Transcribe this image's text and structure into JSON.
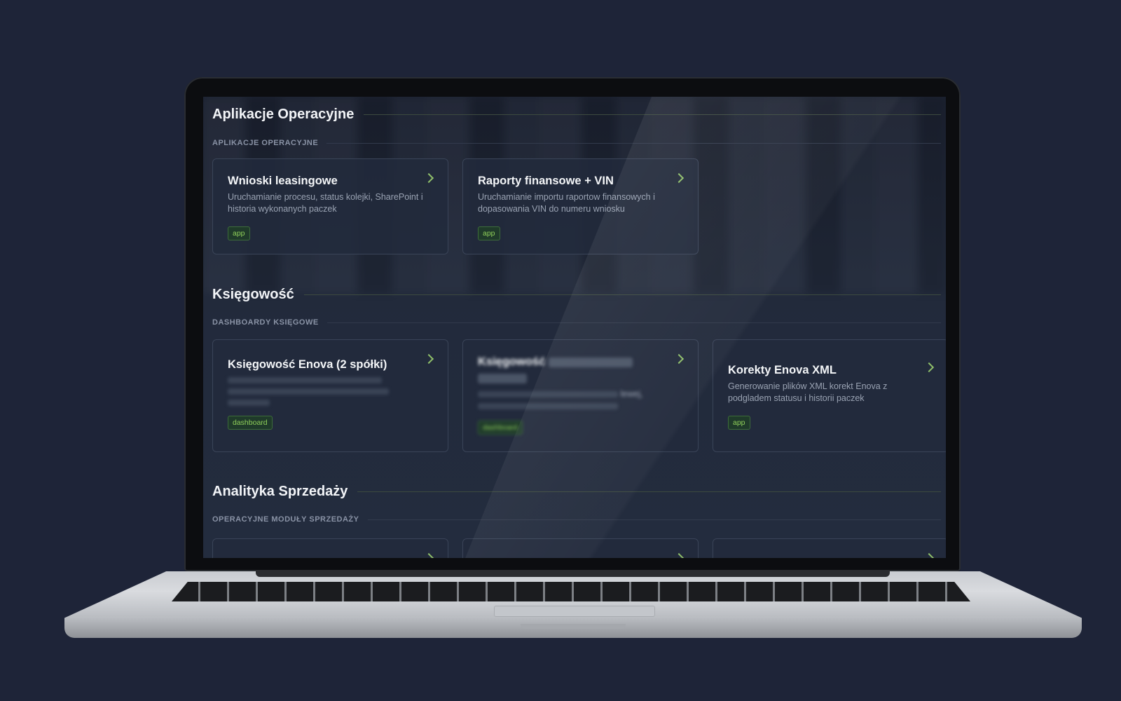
{
  "sections": [
    {
      "title": "Aplikacje Operacyjne",
      "subtitle": "APLIKACJE OPERACYJNE",
      "cards": [
        {
          "title": "Wnioski leasingowe",
          "desc": "Uruchamianie procesu, status kolejki, SharePoint i historia wykonanych paczek",
          "tag": "app"
        },
        {
          "title": "Raporty finansowe + VIN",
          "desc": "Uruchamianie importu raportow finansowych i dopasowania VIN do numeru wniosku",
          "tag": "app"
        }
      ]
    },
    {
      "title": "Księgowość",
      "subtitle": "DASHBOARDY KSIĘGOWE",
      "cards": [
        {
          "title": "Księgowość Enova (2 spółki)",
          "desc": "",
          "tag": "dashboard"
        },
        {
          "title": "Księgowość",
          "desc": "lewej,",
          "tag": "dashboard"
        },
        {
          "title": "Korekty Enova XML",
          "desc": "Generowanie plików XML korekt Enova z podgladem statusu i historii paczek",
          "tag": "app"
        }
      ]
    },
    {
      "title": "Analityka Sprzedaży",
      "subtitle": "OPERACYJNE MODUŁY SPRZEDAŻY"
    }
  ],
  "icons": {
    "card_arrow": "chevron-right-icon"
  },
  "colors": {
    "accent": "#8fcf5a",
    "background": "#1e2438"
  }
}
